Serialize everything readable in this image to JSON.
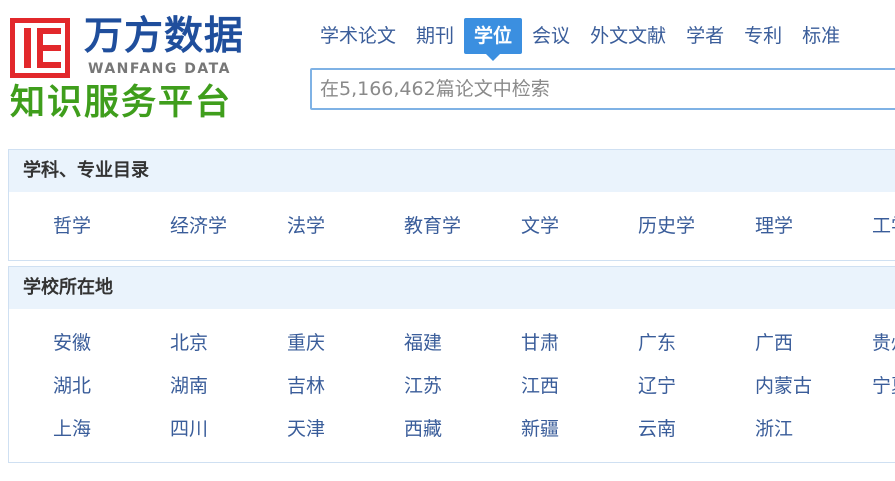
{
  "brand": {
    "name_cn": "万方数据",
    "name_en": "WANFANG DATA",
    "tagline": "知识服务平台",
    "accent": "#1f4e9c",
    "logo_red": "#e2282b",
    "tagline_green": "#3f9e1c"
  },
  "nav": {
    "items": [
      "学术论文",
      "期刊",
      "学位",
      "会议",
      "外文文献",
      "学者",
      "专利",
      "标准"
    ],
    "active": "学位",
    "active_color": "#3b8fe0"
  },
  "search": {
    "placeholder": "在5,166,462篇论文中检索",
    "value": ""
  },
  "subjects": {
    "title": "学科、专业目录",
    "items": [
      "哲学",
      "经济学",
      "法学",
      "教育学",
      "文学",
      "历史学",
      "理学",
      "工学"
    ]
  },
  "locations": {
    "title": "学校所在地",
    "rows": [
      [
        "安徽",
        "北京",
        "重庆",
        "福建",
        "甘肃",
        "广东",
        "广西",
        "贵州"
      ],
      [
        "湖北",
        "湖南",
        "吉林",
        "江苏",
        "江西",
        "辽宁",
        "内蒙古",
        "宁夏"
      ],
      [
        "上海",
        "四川",
        "天津",
        "西藏",
        "新疆",
        "云南",
        "浙江"
      ]
    ]
  }
}
